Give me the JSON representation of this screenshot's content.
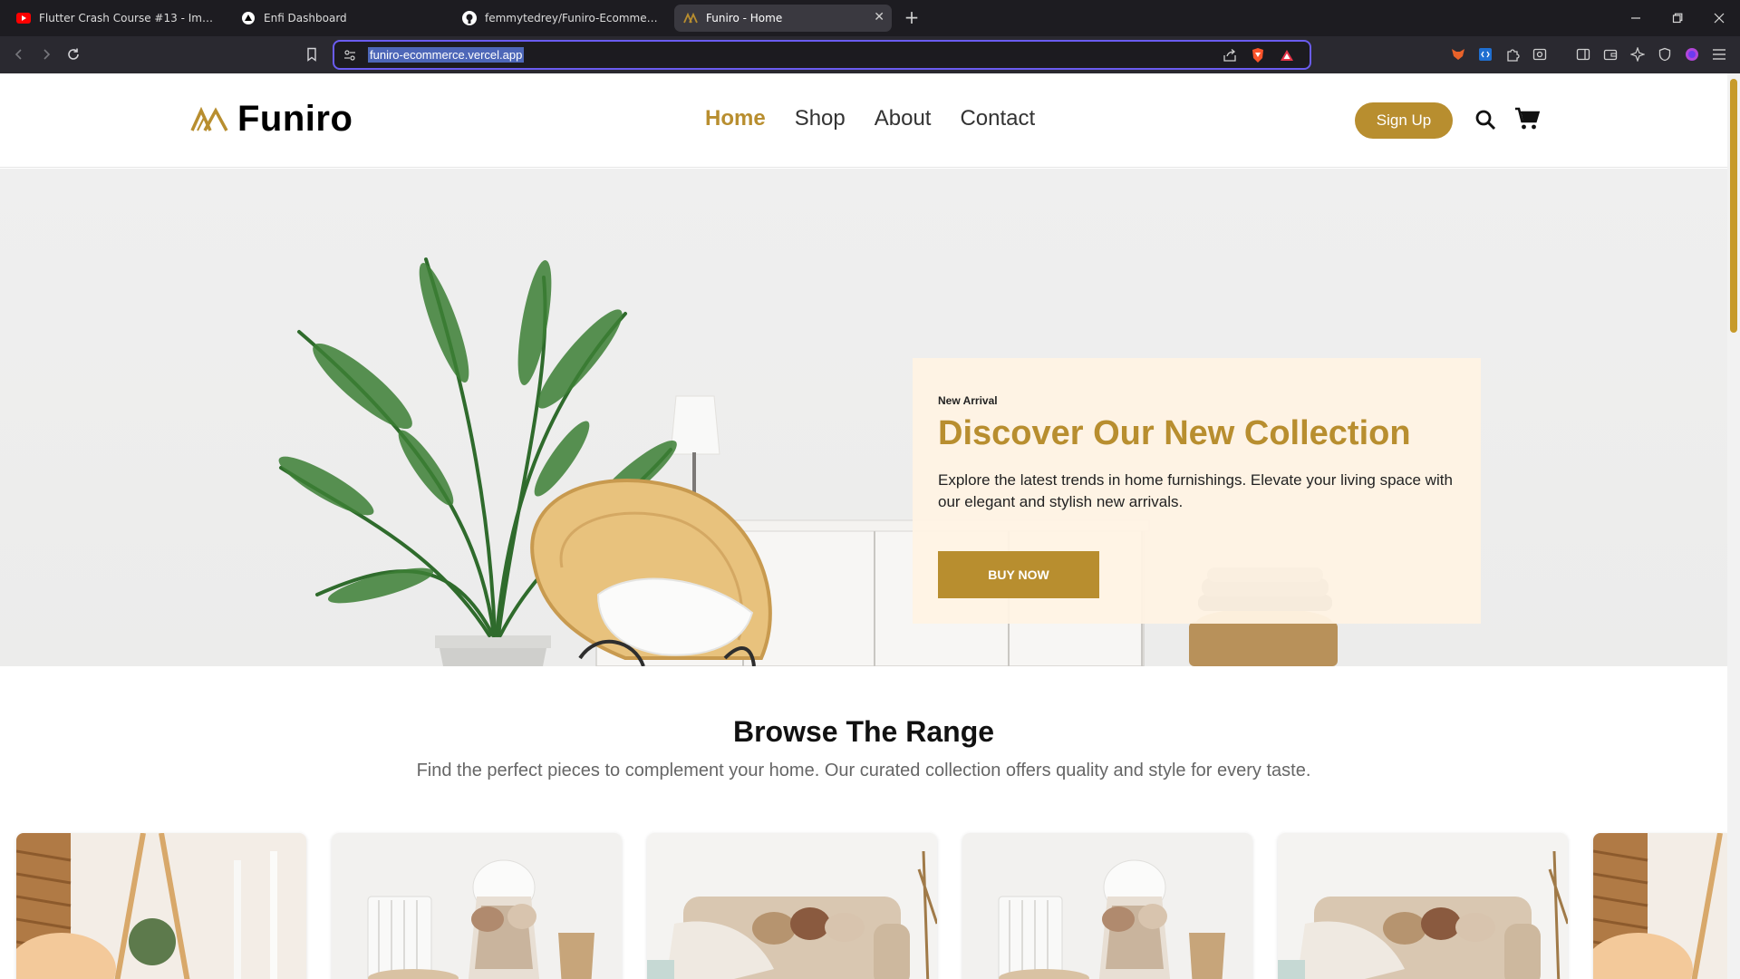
{
  "browser": {
    "tabs": [
      {
        "title": "Flutter Crash Course #13 - Images - YouTube",
        "icon": "youtube-icon",
        "active": false
      },
      {
        "title": "Enfi Dashboard",
        "icon": "vercel-icon",
        "active": false
      },
      {
        "title": "femmytedrey/Funiro-Ecommerce",
        "icon": "github-icon",
        "active": false
      },
      {
        "title": "Funiro - Home",
        "icon": "funiro-icon",
        "active": true
      }
    ],
    "url": "funiro-ecommerce.vercel.app"
  },
  "site": {
    "brand": "Funiro",
    "nav": [
      {
        "label": "Home",
        "active": true
      },
      {
        "label": "Shop",
        "active": false
      },
      {
        "label": "About",
        "active": false
      },
      {
        "label": "Contact",
        "active": false
      }
    ],
    "signup_label": "Sign Up",
    "accent": "#b88e2f"
  },
  "hero": {
    "eyebrow": "New Arrival",
    "title": "Discover Our New Collection",
    "description": "Explore the latest trends in home furnishings. Elevate your living space with our elegant and stylish new arrivals.",
    "button": "BUY NOW"
  },
  "range": {
    "title": "Browse The Range",
    "subtitle": "Find the perfect pieces to complement your home. Our curated collection offers quality and style for every taste.",
    "products": [
      {
        "image": "bedroom-corner-image"
      },
      {
        "image": "chair-blanket-image"
      },
      {
        "image": "living-sofa-image"
      },
      {
        "image": "chair-blanket-image"
      },
      {
        "image": "living-sofa-image"
      },
      {
        "image": "bedroom-corner-image"
      }
    ]
  }
}
